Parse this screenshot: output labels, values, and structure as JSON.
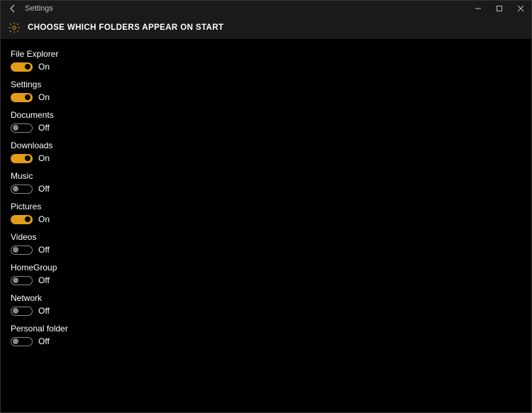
{
  "window": {
    "app_title": "Settings"
  },
  "header": {
    "title": "CHOOSE WHICH FOLDERS APPEAR ON START"
  },
  "states": {
    "on": "On",
    "off": "Off"
  },
  "items": [
    {
      "label": "File Explorer",
      "on": true
    },
    {
      "label": "Settings",
      "on": true
    },
    {
      "label": "Documents",
      "on": false
    },
    {
      "label": "Downloads",
      "on": true
    },
    {
      "label": "Music",
      "on": false
    },
    {
      "label": "Pictures",
      "on": true
    },
    {
      "label": "Videos",
      "on": false
    },
    {
      "label": "HomeGroup",
      "on": false
    },
    {
      "label": "Network",
      "on": false
    },
    {
      "label": "Personal folder",
      "on": false
    }
  ],
  "colors": {
    "accent": "#e29c18",
    "bg": "#000000",
    "bar": "#1a1a1a"
  }
}
